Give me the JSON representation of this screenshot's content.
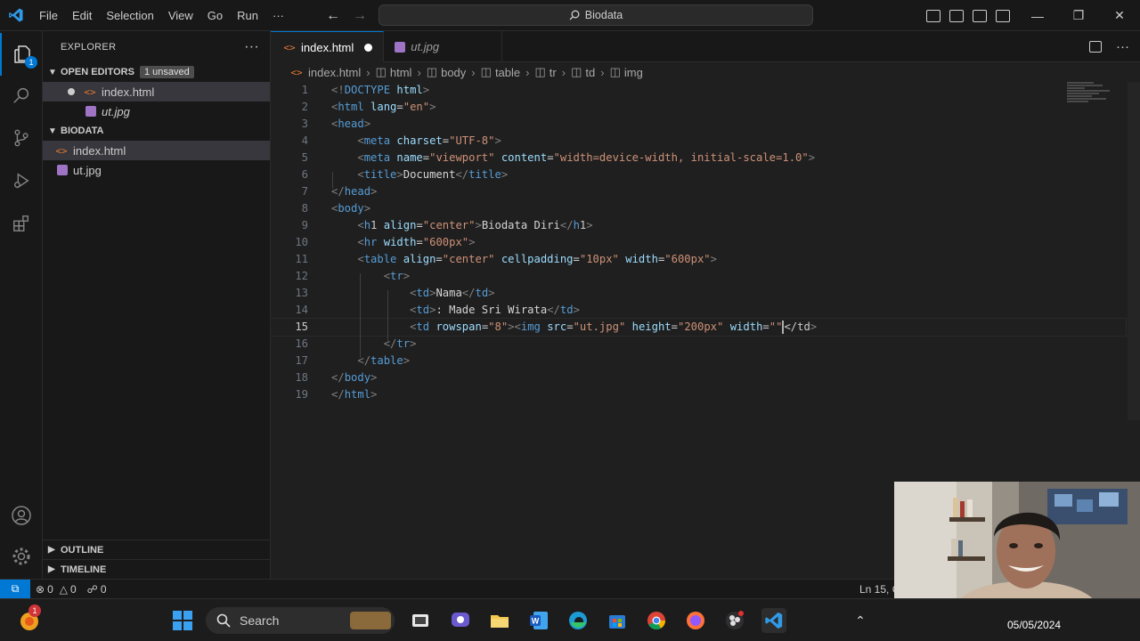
{
  "titlebar": {
    "menu": [
      "File",
      "Edit",
      "Selection",
      "View",
      "Go",
      "Run",
      "···"
    ],
    "search_text": "Biodata"
  },
  "sidebar": {
    "title": "EXPLORER",
    "open_editors_label": "OPEN EDITORS",
    "unsaved_badge": "1 unsaved",
    "open_editors": [
      {
        "name": "index.html",
        "icon": "html-file-icon",
        "modified": true
      },
      {
        "name": "ut.jpg",
        "icon": "image-file-icon",
        "modified": false
      }
    ],
    "folder_label": "BIODATA",
    "files": [
      {
        "name": "index.html",
        "icon": "html-file-icon"
      },
      {
        "name": "ut.jpg",
        "icon": "image-file-icon"
      }
    ],
    "outline_label": "OUTLINE",
    "timeline_label": "TIMELINE"
  },
  "activity_badge": "1",
  "tabs": [
    {
      "label": "index.html",
      "active": true,
      "modified": true
    },
    {
      "label": "ut.jpg",
      "active": false,
      "modified": false
    }
  ],
  "breadcrumb": [
    "index.html",
    "html",
    "body",
    "table",
    "tr",
    "td",
    "img"
  ],
  "code": {
    "current_line": 15,
    "lines": [
      "<!DOCTYPE html>",
      "<html lang=\"en\">",
      "<head>",
      "    <meta charset=\"UTF-8\">",
      "    <meta name=\"viewport\" content=\"width=device-width, initial-scale=1.0\">",
      "    <title>Document</title>",
      "</head>",
      "<body>",
      "    <h1 align=\"center\">Biodata Diri</h1>",
      "    <hr width=\"600px\">",
      "    <table align=\"center\" cellpadding=\"10px\" width=\"600px\">",
      "        <tr>",
      "            <td>Nama</td>",
      "            <td>: Made Sri Wirata</td>",
      "            <td rowspan=\"8\"><img src=\"ut.jpg\" height=\"200px\" width=\"\"</td>",
      "        </tr>",
      "    </table>",
      "</body>",
      "</html>"
    ]
  },
  "statusbar": {
    "errors": "0",
    "warnings": "0",
    "ports": "0",
    "position": "Ln 15, C"
  },
  "taskbar": {
    "search_placeholder": "Search",
    "date": "05/05/2024",
    "notification_count": "1"
  },
  "colors": {
    "accent": "#0078d4",
    "tag": "#569cd6",
    "attribute": "#9cdcfe",
    "string": "#ce9178"
  }
}
